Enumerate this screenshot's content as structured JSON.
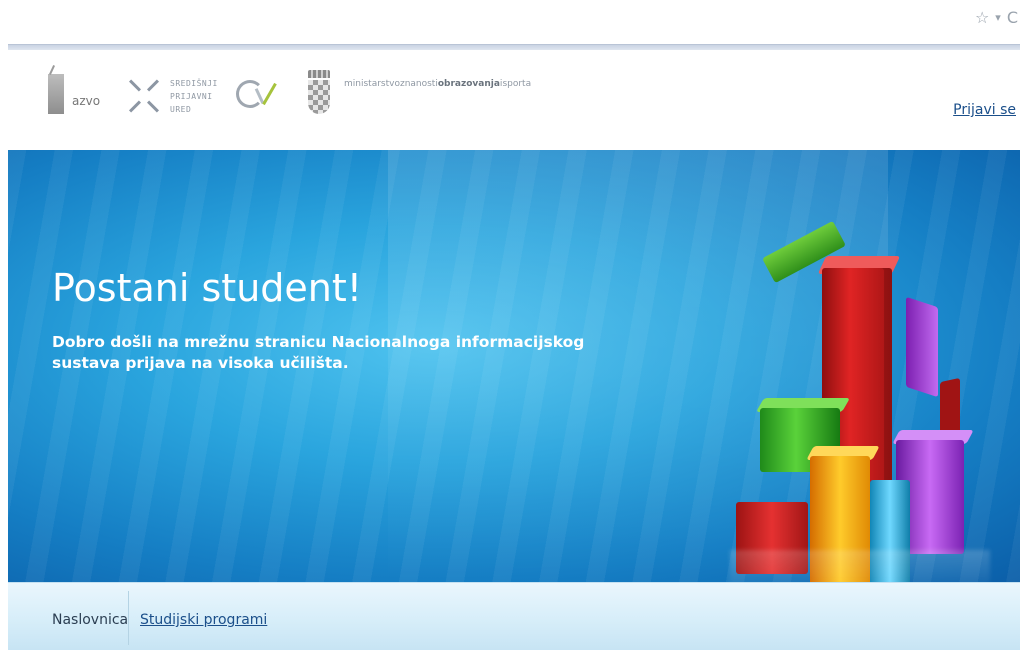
{
  "browser": {
    "star_icon": "☆",
    "dropdown_icon": "▾",
    "reload_icon": "C"
  },
  "header": {
    "logos": {
      "azvo": "azvo",
      "spu": [
        "SREDIŠNJI",
        "PRIJAVNI",
        "URED"
      ],
      "ministry": {
        "part1": "ministarstvo",
        "part2": "znanosti",
        "part3": "obrazovanja",
        "part4": "i",
        "part5": "sporta"
      }
    },
    "login_label": "Prijavi se"
  },
  "hero": {
    "title": "Postani student!",
    "subtitle": "Dobro došli na mrežnu stranicu Nacionalnoga informacijskog sustava prijava na visoka učilišta."
  },
  "nav": {
    "items": [
      {
        "label": "Naslovnica"
      },
      {
        "label": "Studijski programi"
      }
    ]
  },
  "colors": {
    "brand_blue": "#157ec4",
    "link_blue": "#1b4f8a",
    "nav_bg": "#d7eef9"
  }
}
